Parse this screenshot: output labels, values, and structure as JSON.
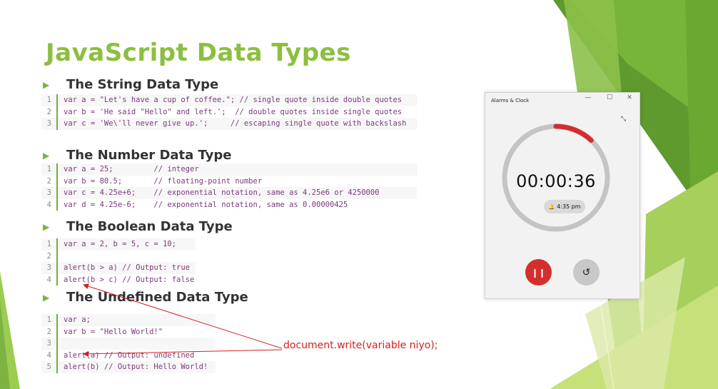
{
  "slide": {
    "title": "JavaScript Data Types",
    "sections": [
      {
        "heading": "The String Data Type",
        "lines": [
          {
            "n": "1",
            "code": "var a = \"Let's have a cup of coffee.\"; // single quote inside double quotes"
          },
          {
            "n": "2",
            "code": "var b = 'He said \"Hello\" and left.';  // double quotes inside single quotes"
          },
          {
            "n": "3",
            "code": "var c = 'We\\'ll never give up.';     // escaping single quote with backslash"
          }
        ]
      },
      {
        "heading": "The Number Data Type",
        "lines": [
          {
            "n": "1",
            "code": "var a = 25;         // integer"
          },
          {
            "n": "2",
            "code": "var b = 80.5;       // floating-point number"
          },
          {
            "n": "3",
            "code": "var c = 4.25e+6;    // exponential notation, same as 4.25e6 or 4250000"
          },
          {
            "n": "4",
            "code": "var d = 4.25e-6;    // exponential notation, same as 0.00000425"
          }
        ]
      },
      {
        "heading": "The Boolean Data Type",
        "lines": [
          {
            "n": "1",
            "code": "var a = 2, b = 5, c = 10;"
          },
          {
            "n": "2",
            "code": ""
          },
          {
            "n": "3",
            "code": "alert(b > a) // Output: true"
          },
          {
            "n": "4",
            "code": "alert(b > c) // Output: false"
          }
        ]
      },
      {
        "heading": "The Undefined Data Type",
        "lines": [
          {
            "n": "1",
            "code": "var a;"
          },
          {
            "n": "2",
            "code": "var b = \"Hello World!\""
          },
          {
            "n": "3",
            "code": ""
          },
          {
            "n": "4",
            "code": "alert(a) // Output: undefined"
          },
          {
            "n": "5",
            "code": "alert(b) // Output: Hello World!"
          }
        ]
      }
    ],
    "annotation": "document.write(variable niyo);",
    "annotation_color": "#d32020"
  },
  "alarm_window": {
    "title": "Alarms & Clock",
    "controls": {
      "minimize": "—",
      "maximize": "☐",
      "close": "✕"
    },
    "shrink_icon": "⤡",
    "timer": "00:00:36",
    "alarm_time": "4:35 pm",
    "bell_icon": "🔔",
    "pause_icon": "❙❙",
    "reset_icon": "↺",
    "progress_fraction": 0.12,
    "accent_color": "#d32f2f"
  },
  "colors": {
    "title_green": "#8cbf3f",
    "bullet_green": "#7cb342"
  }
}
